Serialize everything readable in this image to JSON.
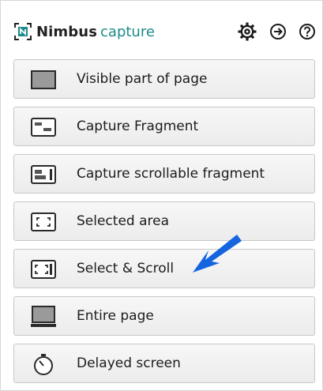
{
  "app": {
    "brand_primary": "Nimbus",
    "brand_secondary": "capture",
    "accent_color": "#1d8b87"
  },
  "header": {
    "icons": [
      "gear-icon",
      "exit-icon",
      "help-icon"
    ]
  },
  "menu": {
    "items": [
      {
        "label": "Visible part of page",
        "icon": "visible-page-icon"
      },
      {
        "label": "Capture Fragment",
        "icon": "fragment-icon"
      },
      {
        "label": "Capture scrollable fragment",
        "icon": "scrollable-fragment-icon"
      },
      {
        "label": "Selected area",
        "icon": "selected-area-icon"
      },
      {
        "label": "Select & Scroll",
        "icon": "select-scroll-icon"
      },
      {
        "label": "Entire page",
        "icon": "entire-page-icon"
      },
      {
        "label": "Delayed screen",
        "icon": "timer-icon"
      }
    ]
  },
  "annotation": {
    "arrow_color": "#1565e0",
    "arrow_target": "Select & Scroll"
  }
}
